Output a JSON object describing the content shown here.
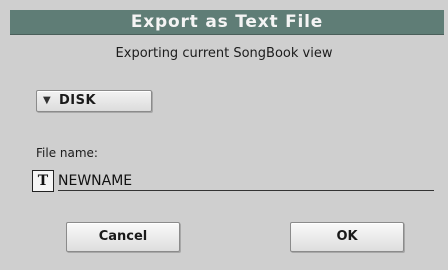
{
  "dialog": {
    "title": "Export as Text File",
    "subtitle": "Exporting current SongBook view"
  },
  "source": {
    "selected": "DISK",
    "icon": "dropdown-arrow-icon"
  },
  "file": {
    "label": "File name:",
    "icon": "text-edit-icon",
    "icon_glyph": "T",
    "value": "NEWNAME"
  },
  "buttons": {
    "cancel": "Cancel",
    "ok": "OK"
  }
}
